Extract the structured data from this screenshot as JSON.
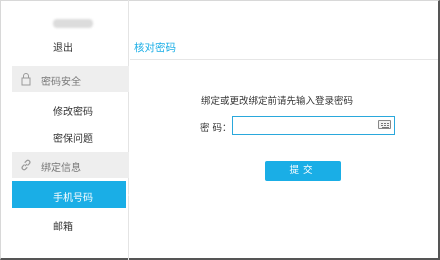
{
  "sidebar": {
    "logout_label": "退出",
    "sections": [
      {
        "label": "密码安全",
        "icon": "lock-icon"
      },
      {
        "label": "绑定信息",
        "icon": "link-icon"
      }
    ],
    "items": {
      "change_password": "修改密码",
      "security_question": "密保问题",
      "phone": "手机号码",
      "email": "邮箱"
    },
    "active_item": "phone"
  },
  "main": {
    "title": "核对密码",
    "prompt": "绑定或更改绑定前请先输入登录密码",
    "password_label": "密  码：",
    "password_value": "",
    "submit_label": "提交"
  },
  "colors": {
    "accent": "#1aaee6",
    "section_bg": "#eeeeee"
  }
}
